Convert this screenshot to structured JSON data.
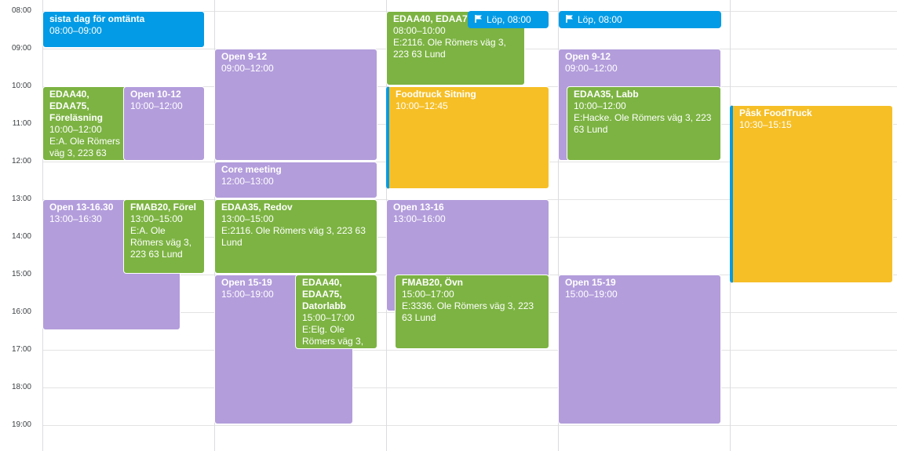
{
  "times": [
    "08:00",
    "09:00",
    "10:00",
    "11:00",
    "12:00",
    "13:00",
    "14:00",
    "15:00",
    "16:00",
    "17:00",
    "18:00",
    "19:00"
  ],
  "allday": [
    {
      "label": "Löp, 08:00"
    },
    {
      "label": "Löp, 08:00"
    }
  ],
  "events": [
    {
      "title": "sista dag för omtänta",
      "time": "08:00–09:00",
      "detail": ""
    },
    {
      "title": "EDAA40, EDAA75, Föreläsning",
      "time": "10:00–12:00",
      "detail": "E:A. Ole Römers väg 3, 223 63 Lund"
    },
    {
      "title": "Open 10-12",
      "time": "10:00–12:00",
      "detail": ""
    },
    {
      "title": "Open 13-16.30",
      "time": "13:00–16:30",
      "detail": ""
    },
    {
      "title": "FMAB20, Förel",
      "time": "13:00–15:00",
      "detail": "E:A. Ole Römers väg 3, 223 63 Lund"
    },
    {
      "title": "Open 9-12",
      "time": "09:00–12:00",
      "detail": ""
    },
    {
      "title": "Core meeting",
      "time": "12:00–13:00",
      "detail": ""
    },
    {
      "title": "EDAA35, Redov",
      "time": "13:00–15:00",
      "detail": "E:2116. Ole Römers väg 3, 223 63 Lund"
    },
    {
      "title": "Open 15-19",
      "time": "15:00–19:00",
      "detail": ""
    },
    {
      "title": "EDAA40, EDAA75, Datorlabb",
      "time": "15:00–17:00",
      "detail": "E:Elg. Ole Römers väg 3,"
    },
    {
      "title": "EDAA40, EDAA75",
      "time": "08:00–10:00",
      "detail": "E:2116. Ole Römers väg 3, 223 63 Lund"
    },
    {
      "title": "Foodtruck Sitning",
      "time": "10:00–12:45",
      "detail": ""
    },
    {
      "title": "Open 13-16",
      "time": "13:00–16:00",
      "detail": ""
    },
    {
      "title": "FMAB20, Övn",
      "time": "15:00–17:00",
      "detail": "E:3336. Ole Römers väg 3, 223 63 Lund"
    },
    {
      "title": "Open 9-12",
      "time": "09:00–12:00",
      "detail": ""
    },
    {
      "title": "EDAA35, Labb",
      "time": "10:00–12:00",
      "detail": "E:Hacke. Ole Römers väg 3, 223 63 Lund"
    },
    {
      "title": "Open 15-19",
      "time": "15:00–19:00",
      "detail": ""
    },
    {
      "title": "Påsk FoodTruck",
      "time": "10:30–15:15",
      "detail": ""
    }
  ],
  "colors": {
    "purple": "#b39ddb",
    "green": "#7cb342",
    "yellow": "#f6bf26",
    "blue": "#039be5"
  },
  "icons": {
    "allday": "flag-icon"
  }
}
